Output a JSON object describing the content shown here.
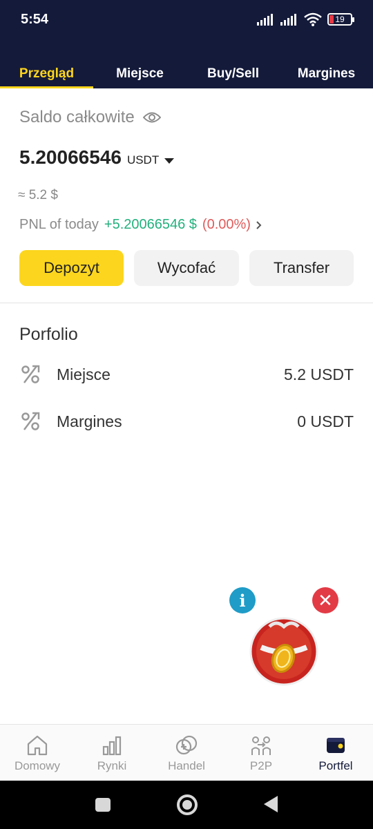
{
  "status": {
    "time": "5:54",
    "battery": "19"
  },
  "tabs": [
    {
      "label": "Przegląd",
      "active": true
    },
    {
      "label": "Miejsce"
    },
    {
      "label": "Buy/Sell"
    },
    {
      "label": "Margines"
    }
  ],
  "balance": {
    "title": "Saldo całkowite",
    "amount": "5.20066546",
    "currency": "USDT",
    "approx": "≈ 5.2 $",
    "pnl_label": "PNL of today",
    "pnl_value": "+5.20066546 $",
    "pnl_percent": "(0.00%)"
  },
  "buttons": {
    "deposit": "Depozyt",
    "withdraw": "Wycofać",
    "transfer": "Transfer"
  },
  "portfolio": {
    "title": "Porfolio",
    "items": [
      {
        "name": "Miejsce",
        "amount": "5.2 USDT"
      },
      {
        "name": "Margines",
        "amount": "0 USDT"
      }
    ]
  },
  "floating": {
    "info_icon": "i",
    "close_icon": "✕"
  },
  "nav": [
    {
      "label": "Domowy"
    },
    {
      "label": "Rynki"
    },
    {
      "label": "Handel"
    },
    {
      "label": "P2P"
    },
    {
      "label": "Portfel",
      "active": true
    }
  ],
  "colors": {
    "accent": "#fcd61e",
    "header": "#141a3a",
    "positive": "#22b07d",
    "negative": "#e05a5a"
  }
}
